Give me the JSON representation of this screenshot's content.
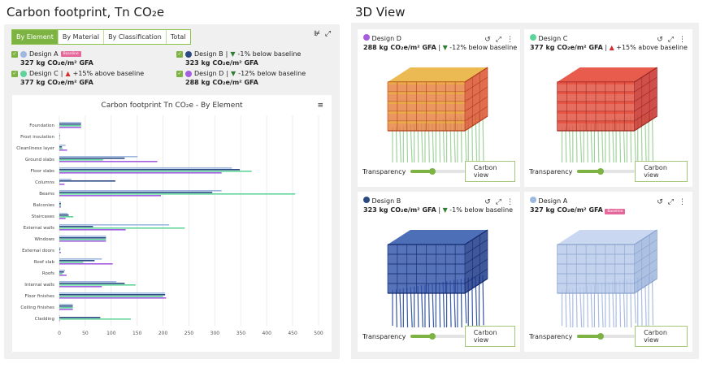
{
  "left": {
    "title": "Carbon footprint, Tn CO₂e",
    "tabs": [
      {
        "label": "By Element",
        "active": true
      },
      {
        "label": "By Material"
      },
      {
        "label": "By Classification"
      },
      {
        "label": "Total"
      }
    ],
    "toolbar_icons": [
      "chart-settings-icon",
      "expand-icon"
    ],
    "legend": [
      {
        "name": "Design A",
        "color": "#9fb8e0",
        "badge": "Baseline",
        "delta": "",
        "value": "327 kg CO₂e/m² GFA",
        "checked": true
      },
      {
        "name": "Design B",
        "color": "#2c4a82",
        "badge": "",
        "trend": "down",
        "delta": "-1% below baseline",
        "value": "323 kg CO₂e/m² GFA",
        "checked": true
      },
      {
        "name": "Design C",
        "color": "#5fd49a",
        "badge": "",
        "trend": "up",
        "delta": "+15% above baseline",
        "value": "377 kg CO₂e/m² GFA",
        "checked": true
      },
      {
        "name": "Design D",
        "color": "#a55ee0",
        "badge": "",
        "trend": "down",
        "delta": "-12% below baseline",
        "value": "288 kg CO₂e/m² GFA",
        "checked": true
      }
    ]
  },
  "chart_data": {
    "type": "bar",
    "orientation": "horizontal",
    "title": "Carbon footprint Tn CO₂e - By Element",
    "categories": [
      "Foundation",
      "Frost insulation",
      "Cleanliness layer",
      "Ground slabs",
      "Floor slabs",
      "Columns",
      "Beams",
      "Balconies",
      "Staircases",
      "External walls",
      "Windows",
      "External doors",
      "Roof slab",
      "Roofs",
      "Internal walls",
      "Floor finishes",
      "Ceiling finishes",
      "Cladding"
    ],
    "series": [
      {
        "name": "Design A",
        "color": "#9fb8e0",
        "values": [
          42,
          1,
          12,
          151,
          333,
          23,
          313,
          3,
          16,
          212,
          90,
          2,
          82,
          11,
          110,
          204,
          26,
          0
        ]
      },
      {
        "name": "Design B",
        "color": "#2c4a82",
        "values": [
          42,
          0,
          5,
          126,
          348,
          108,
          295,
          3,
          18,
          65,
          90,
          2,
          68,
          9,
          126,
          204,
          26,
          79
        ]
      },
      {
        "name": "Design C",
        "color": "#5fd49a",
        "values": [
          42,
          0,
          6,
          84,
          371,
          0,
          455,
          3,
          27,
          242,
          90,
          1,
          46,
          6,
          147,
          200,
          26,
          138
        ]
      },
      {
        "name": "Design D",
        "color": "#a55ee0",
        "values": [
          42,
          1,
          15,
          189,
          313,
          10,
          196,
          3,
          12,
          128,
          90,
          3,
          103,
          14,
          82,
          206,
          26,
          0
        ]
      }
    ],
    "xlim": [
      0,
      500
    ],
    "xticks": [
      "0",
      "50",
      "100",
      "150",
      "200",
      "250",
      "300",
      "350",
      "400",
      "450",
      "500"
    ],
    "grid": true,
    "legend": "none"
  },
  "right": {
    "title": "3D View",
    "cards": [
      {
        "name": "Design D",
        "color": "#a55ee0",
        "value": "288 kg CO₂e/m² GFA",
        "trend": "down",
        "delta": "-12% below baseline",
        "badge": "",
        "transparency": 40,
        "button": "Carbon view",
        "transparency_label": "Transparency"
      },
      {
        "name": "Design C",
        "color": "#5fd49a",
        "value": "377 kg CO₂e/m² GFA",
        "trend": "up",
        "delta": "+15% above baseline",
        "badge": "",
        "transparency": 40,
        "button": "Carbon view",
        "transparency_label": "Transparency"
      },
      {
        "name": "Design B",
        "color": "#2c4a82",
        "value": "323 kg CO₂e/m² GFA",
        "trend": "down",
        "delta": "-1% below baseline",
        "badge": "",
        "transparency": 40,
        "button": "Carbon view",
        "transparency_label": "Transparency"
      },
      {
        "name": "Design A",
        "color": "#9fb8e0",
        "value": "327 kg CO₂e/m² GFA",
        "trend": "",
        "delta": "",
        "badge": "Baseline",
        "transparency": 40,
        "button": "Carbon view",
        "transparency_label": "Transparency"
      }
    ]
  }
}
